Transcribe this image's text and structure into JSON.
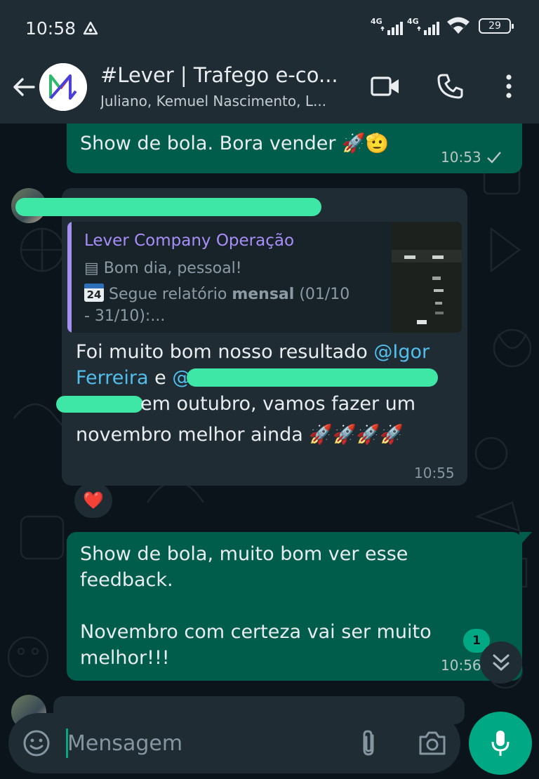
{
  "status_bar": {
    "time": "10:58",
    "network_1": "4G",
    "network_2": "4G",
    "battery": "29"
  },
  "header": {
    "title": "#Lever | Trafego e-co...",
    "subtitle": "Juliano, Kemuel Nascimento, L..."
  },
  "messages": {
    "m1": {
      "text": "Show de bola. Bora vender 🚀🫡",
      "time": "10:53"
    },
    "m2": {
      "quote": {
        "sender": "Lever Company Operação",
        "line1": "Bom dia, pessoal!",
        "line2_pre": "Segue relatório ",
        "line2_bold": "mensal",
        "line2_post": " (01/10",
        "line3": "- 31/10):..."
      },
      "line1_text": "Foi muito bom nosso resultado ",
      "line1_mention": "@Igor",
      "line2_mention": "Ferreira",
      "line2_e": " e ",
      "line2_at": "@",
      "line3_text": " em outubro, vamos fazer um",
      "line4_text": "novembro melhor ainda 🚀🚀🚀🚀",
      "time": "10:55",
      "reaction": "❤️"
    },
    "m3": {
      "line1": "Show de bola, muito bom ver esse",
      "line2": "feedback.",
      "line3": "Novembro com certeza vai ser muito",
      "line4": "melhor!!!",
      "time": "10:56"
    }
  },
  "unread_count": "1",
  "composer": {
    "placeholder": "Mensagem"
  },
  "colors": {
    "outgoing_bubble": "#005c4b",
    "incoming_bubble": "#1f2c34",
    "accent": "#00a884",
    "mention": "#53bdeb",
    "quote_sender": "#a88ef8",
    "redaction_highlight": "#3fe7a7"
  }
}
